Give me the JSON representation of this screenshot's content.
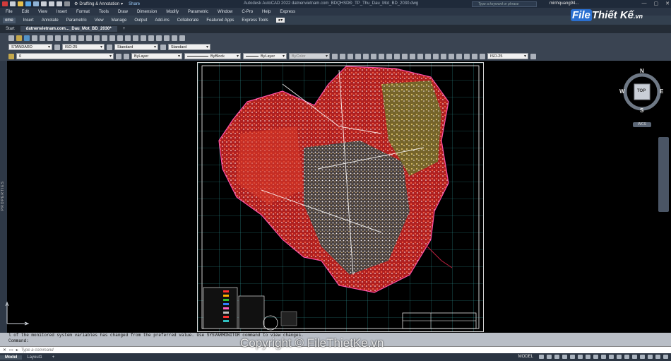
{
  "titlebar": {
    "workspace": "Drafting & Annotation",
    "share": "Share",
    "app_title": "Autodesk AutoCAD 2022   datnenvietnam.com_BDQHSDĐ_TP_Thu_Dau_Mot_BD_2030.dwg",
    "search_placeholder": "Type a keyword or phrase",
    "user": "minhquang94...",
    "minimize": "—",
    "maximize": "▢",
    "close": "✕"
  },
  "menu": [
    "File",
    "Edit",
    "View",
    "Insert",
    "Format",
    "Tools",
    "Draw",
    "Dimension",
    "Modify",
    "Parametric",
    "Window",
    "C-Pro",
    "Help",
    "Express"
  ],
  "ribbon_tabs": [
    "ome",
    "Insert",
    "Annotate",
    "Parametric",
    "View",
    "Manage",
    "Output",
    "Add-ins",
    "Collaborate",
    "Featured Apps",
    "Express Tools"
  ],
  "doc_tabs": {
    "start": "Start",
    "drawing": "datnenvietnam.com..._Dau_Mot_BD_2030*",
    "add": "+"
  },
  "styles": {
    "text_style": "STANDARD",
    "dim_style": "ISO-25",
    "table_style": "Standard",
    "multileader_style": "Standard"
  },
  "properties_bar": {
    "layer": "0",
    "color": "ByLayer",
    "linetype": "ByBlock",
    "lineweight": "ByLayer",
    "plotstyle": "ByColor",
    "dim_style_2": "ISO-25"
  },
  "viewcube": {
    "n": "N",
    "s": "S",
    "e": "E",
    "w": "W",
    "face": "TOP",
    "wcs": "WCS"
  },
  "canvas": {
    "properties_label": "PROPERTIES"
  },
  "command": {
    "history_1": "l of the monitored system variables has changed from the preferred value. Use SYSVARMONITOR command to view changes.",
    "history_2": "Command:",
    "placeholder": "Type a command"
  },
  "status": {
    "tab_model": "Model",
    "tab_layout1": "Layout1",
    "add": "+",
    "model_label": "MODEL"
  },
  "watermark": {
    "logo_part1": "File",
    "logo_part2": "Thiết Kế",
    "logo_part3": ".vn",
    "copyright": "Copyright © FileThietKe.vn"
  }
}
